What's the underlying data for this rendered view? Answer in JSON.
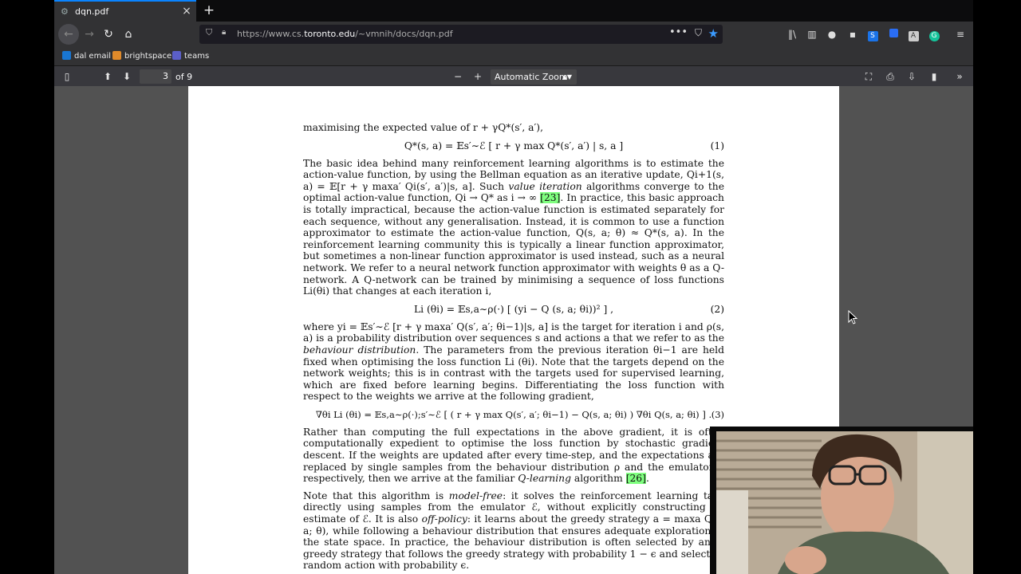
{
  "tab": {
    "title": "dqn.pdf"
  },
  "url": {
    "prefix": "https://www.cs.",
    "domain": "toronto.edu",
    "path": "/~vmnih/docs/dqn.pdf"
  },
  "bookmarks": [
    {
      "label": "dal email",
      "color": "#1976d2"
    },
    {
      "label": "brightspace",
      "color": "#e08a2a"
    },
    {
      "label": "teams",
      "color": "#5b5fc7"
    }
  ],
  "pdf_toolbar": {
    "page": "3",
    "of_pages": "of 9",
    "zoom": "Automatic Zoom"
  },
  "doc": {
    "intro": "maximising the expected value of r + γQ*(s′, a′),",
    "eq1": "Q*(s, a) = 𝔼s′∼ℰ [ r + γ max Q*(s′, a′) | s, a ]",
    "eq1_num": "(1)",
    "para1a": "The basic idea behind many reinforcement learning algorithms is to estimate the action-value function, by using the Bellman equation as an iterative update, Qi+1(s, a) = 𝔼[r + γ maxa′ Qi(s′, a′)|s, a]. Such",
    "para1b": "value iteration",
    "para1c": "algorithms converge to the optimal action-value function, Qi → Q* as i → ∞",
    "para1cite": "[23]",
    "para1d": ". In practice, this basic approach is totally impractical, because the action-value function is estimated separately for each sequence, without any generalisation. Instead, it is common to use a function approximator to estimate the action-value function, Q(s, a; θ) ≈ Q*(s, a). In the reinforcement learning community this is typically a linear function approximator, but sometimes a non-linear function approximator is used instead, such as a neural network. We refer to a neural network function approximator with weights θ as a Q-network. A Q-network can be trained by minimising a sequence of loss functions Li(θi) that changes at each iteration i,",
    "eq2": "Li (θi) = 𝔼s,a∼ρ(·) [ (yi − Q (s, a; θi))² ] ,",
    "eq2_num": "(2)",
    "para2a": "where yi = 𝔼s′∼ℰ [r + γ maxa′ Q(s′, a′; θi−1)|s, a] is the target for iteration i and ρ(s, a) is a probability distribution over sequences s and actions a that we refer to as the",
    "para2b": "behaviour distribution",
    "para2c": ". The parameters from the previous iteration θi−1 are held fixed when optimising the loss function Li (θi). Note that the targets depend on the network weights; this is in contrast with the targets used for supervised learning, which are fixed before learning begins. Differentiating the loss function with respect to the weights we arrive at the following gradient,",
    "eq3": "∇θi Li (θi) = 𝔼s,a∼ρ(·);s′∼ℰ [ ( r + γ max Q(s′, a′; θi−1) − Q(s, a; θi) ) ∇θi Q(s, a; θi) ] .",
    "eq3_num": "(3)",
    "para3a": "Rather than computing the full expectations in the above gradient, it is often computationally expedient to optimise the loss function by stochastic gradient descent. If the weights are updated after every time-step, and the expectations are replaced by single samples from the behaviour distribution ρ and the emulator ℰ respectively, then we arrive at the familiar",
    "para3b": "Q-learning",
    "para3c": "algorithm",
    "para3cite": "[26]",
    "para3d": ".",
    "para4a": "Note that this algorithm is",
    "para4b": "model-free",
    "para4c": ": it solves the reinforcement learning task directly using samples from the emulator ℰ, without explicitly constructing an estimate of ℰ. It is also",
    "para4d": "off-policy",
    "para4e": ": it learns about the greedy strategy a = maxa Q(s, a; θ), while following a behaviour distribution that ensures adequate exploration of the state space. In practice, the behaviour distribution is often selected by an ϵ-greedy strategy that follows the greedy strategy with probability 1 − ϵ and selects a random action with probability ϵ."
  },
  "colors": {
    "star": "#3b9bff",
    "cite": "#7fff7f",
    "tab_accent": "#0a84ff"
  }
}
